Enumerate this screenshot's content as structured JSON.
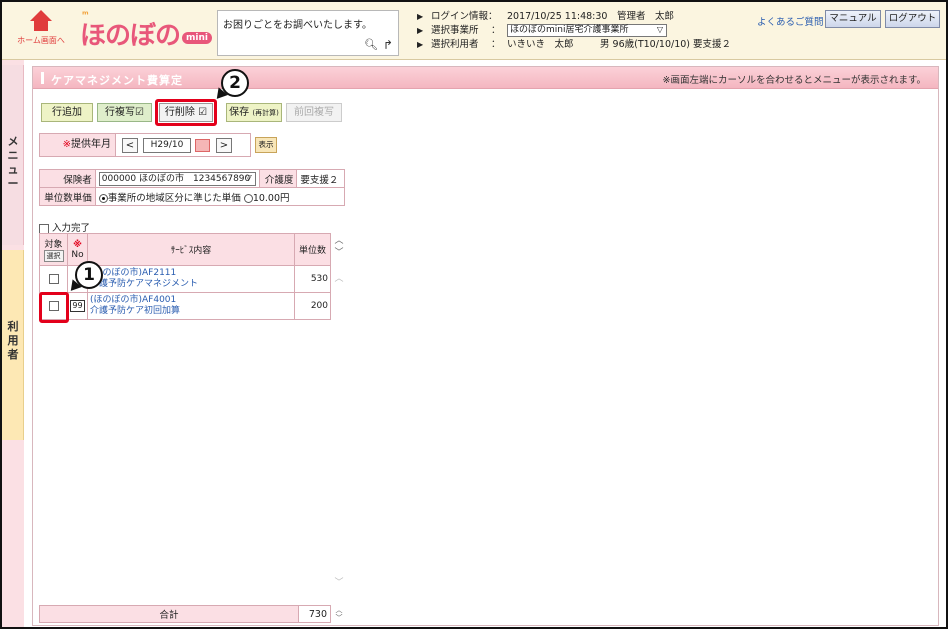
{
  "header": {
    "home_label": "ホーム画面へ",
    "logo_text": "ほのぼの",
    "logo_badge": "mini",
    "search_placeholder": "お困りごとをお調べいたします。",
    "login_label": "ログイン情報：",
    "login_value": "2017/10/25 11:48:30　管理者　太郎",
    "office_label": "選択事業所",
    "office_value": "ほのぼのmini居宅介護事業所",
    "user_label": "選択利用者",
    "user_name": "いきいき　太郎",
    "user_detail": "男 96歳(T10/10/10) 要支援２",
    "colon": "：",
    "faq": "よくあるご質問",
    "manual": "マニュアル",
    "logout": "ログアウト"
  },
  "side": {
    "menu_label": [
      "メ",
      "ニ",
      "ュ",
      "ー"
    ],
    "user_label": [
      "利",
      "用",
      "者"
    ]
  },
  "panel": {
    "title": "ケアマネジメント費算定",
    "hint": "※画面左端にカーソルを合わせるとメニューが表示されます。"
  },
  "toolbar": {
    "add": "行追加",
    "copy": "行複写☑",
    "delete": "行削除 ☑",
    "save": "保存",
    "save_sub": "(再計算)",
    "prev_copy": "前回複写"
  },
  "callouts": {
    "one": "1",
    "two": "2"
  },
  "month": {
    "required_mark": "※",
    "label": "提供年月",
    "value": "H29/10",
    "show": "表示",
    "prev_arrow": "<",
    "next_arrow": ">"
  },
  "insurance": {
    "insurer_label": "保険者",
    "insurer_value": "000000 ほのぼの市　1234567890",
    "care_label": "介護度",
    "care_value": "要支援２",
    "unit_label": "単位数単価",
    "option_regional": "事業所の地域区分に準じた単価",
    "option_fixed": "10.00円"
  },
  "entry_done": "入力完了",
  "service_table": {
    "col_target": "対象",
    "col_select": "選択",
    "col_req": "※",
    "col_no": "No",
    "col_content": "ｻｰﾋﾞｽ内容",
    "col_units": "単位数",
    "rows": [
      {
        "code": "",
        "line1": "(ほのぼの市)AF2111",
        "line2": "介護予防ケアマネジメント",
        "units": "530"
      },
      {
        "code": "99",
        "line1": "(ほのぼの市)AF4001",
        "line2": "介護予防ケア初回加算",
        "units": "200"
      }
    ]
  },
  "total": {
    "label": "合計",
    "value": "730"
  },
  "colors": {
    "accent_pink": "#f4b6c0",
    "highlight_red": "#e3001b",
    "link_blue": "#2a5db0"
  }
}
